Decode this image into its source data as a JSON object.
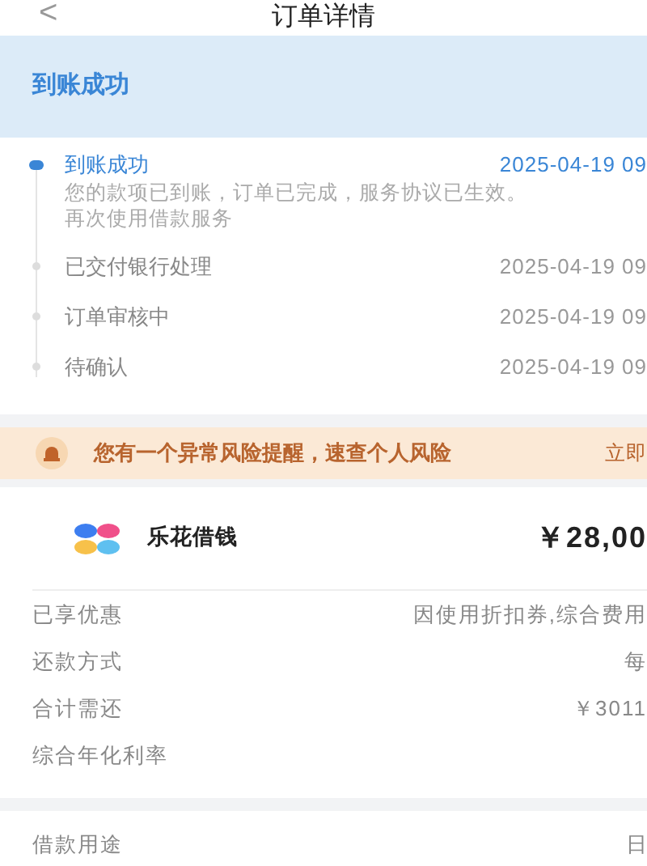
{
  "header": {
    "back": "<",
    "title": "订单详情"
  },
  "status_banner": {
    "title": "到账成功"
  },
  "timeline": [
    {
      "label": "到账成功",
      "time": "2025-04-19 09",
      "active": true,
      "description": [
        "您的款项已到账，订单已完成，服务协议已生效。",
        "再次使用借款服务"
      ]
    },
    {
      "label": "已交付银行处理",
      "time": "2025-04-19 09",
      "active": false
    },
    {
      "label": "订单审核中",
      "time": "2025-04-19 09",
      "active": false
    },
    {
      "label": "待确认",
      "time": "2025-04-19 09",
      "active": false
    }
  ],
  "risk_notice": {
    "text": "您有一个异常风险提醒，速查个人风险",
    "action": "立即"
  },
  "loan_card": {
    "product": "乐花借钱",
    "amount": "￥28,00",
    "rows": [
      {
        "label": "已享优惠",
        "value": "因使用折扣券,综合费用"
      },
      {
        "label": "还款方式",
        "value": "每"
      },
      {
        "label": "合计需还",
        "value": "￥3011"
      },
      {
        "label": "综合年化利率"
      }
    ]
  },
  "details": [
    {
      "label": "借款用途",
      "value": "日"
    }
  ]
}
